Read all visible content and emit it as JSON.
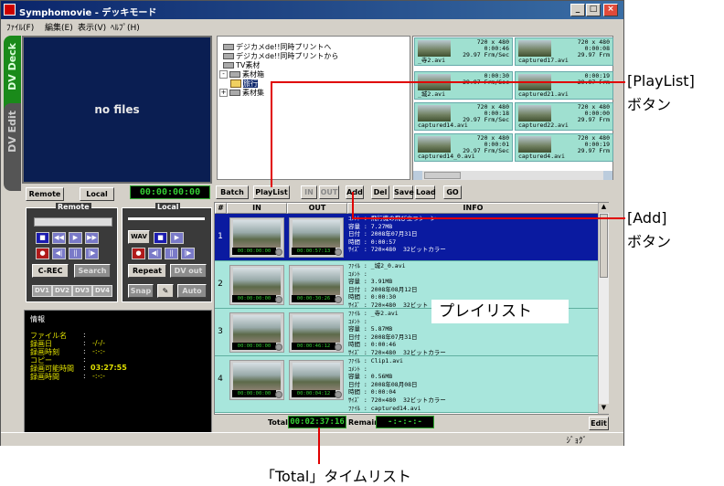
{
  "window": {
    "title": "Symphomovie - デッキモード",
    "controls": [
      "_",
      "□",
      "×"
    ]
  },
  "menu": [
    "ﾌｧｲﾙ(F)",
    "編集(E)",
    "表示(V)",
    "ﾍﾙﾌﾟ(H)"
  ],
  "side_tabs": {
    "deck": "DV Deck",
    "edit": "DV Edit"
  },
  "preview": {
    "text": "no files"
  },
  "tree": {
    "items": [
      {
        "label": "デジカメde!!同時プリントへ",
        "type": "drive"
      },
      {
        "label": "デジカメde!!同時プリントから",
        "type": "drive"
      },
      {
        "label": "TV素材",
        "type": "drive"
      },
      {
        "label": "素材箱",
        "type": "folder",
        "expanded": true
      },
      {
        "label": "旅行",
        "type": "folder",
        "selected": true
      },
      {
        "label": "素材集",
        "type": "folder"
      }
    ]
  },
  "thumbs": [
    {
      "name": "_寺2.avi",
      "res": "720 x 480",
      "dur": "0:00:46",
      "fps": "29.97 Frm/Sec"
    },
    {
      "name": "captured17.avi",
      "res": "720 x 480",
      "dur": "0:00:08",
      "fps": "29.97 Frm"
    },
    {
      "name": "_城2.avi",
      "res": "",
      "dur": "0:00:30",
      "fps": "29.97 Frm/Sec"
    },
    {
      "name": "captured21.avi",
      "res": "",
      "dur": "0:00:19",
      "fps": "29.97 Frm"
    },
    {
      "name": "captured14.avi",
      "res": "720 x 480",
      "dur": "0:00:18",
      "fps": "29.97 Frm/Sec"
    },
    {
      "name": "captured22.avi",
      "res": "720 x 480",
      "dur": "0:00:00",
      "fps": "29.97 Frm"
    },
    {
      "name": "captured14_0.avi",
      "res": "720 x 480",
      "dur": "0:00:01",
      "fps": "29.97 Frm/Sec"
    },
    {
      "name": "captured4.avi",
      "res": "720 x 480",
      "dur": "0:00:19",
      "fps": "29.97 Frm"
    }
  ],
  "deck": {
    "remote_btn": "Remote",
    "local_btn": "Local",
    "timecode": "00:00:00:00",
    "remote_group": "Remote",
    "local_group": "Local",
    "crec": "C-REC",
    "search": "Search",
    "repeat": "Repeat",
    "dvout": "DV out",
    "wav": "WAV",
    "snap": "Snap",
    "auto": "Auto",
    "dv_buttons": [
      "DV1",
      "DV2",
      "DV3",
      "DV4"
    ]
  },
  "info": {
    "heading": "情報",
    "rows": [
      {
        "label": "ファイル名",
        "value": ""
      },
      {
        "label": "録画日",
        "value": "-/-/-"
      },
      {
        "label": "録画時刻",
        "value": "-:-:-"
      },
      {
        "label": "コピー",
        "value": ""
      },
      {
        "label": "録画可能時間",
        "value": "03:27:55"
      },
      {
        "label": "録画時間",
        "value": "-:-:-"
      }
    ]
  },
  "toolbar": {
    "batch": "Batch",
    "playlist": "PlayList",
    "in": "IN",
    "out": "OUT",
    "add": "Add",
    "del": "Del",
    "save": "Save",
    "load": "Load",
    "go": "GO"
  },
  "table": {
    "headers": [
      "#",
      "IN",
      "OUT",
      "INFO"
    ],
    "rows": [
      {
        "num": "1",
        "in_tc": "00:00:00:00",
        "out_tc": "00:00:57:13",
        "info": "ｺﾒﾝﾄ : 飛行機の飛び立つシーン\n容量 : 7.27MB\n日付 : 2008年07月31日\n時間 : 0:00:57\nｻｲｽﾞ : 720×480  32ビットカラー"
      },
      {
        "num": "2",
        "in_tc": "00:00:00:00",
        "out_tc": "00:00:30:26",
        "info": "ﾌｧｲﾙ : _城2_0.avi\nｺﾒﾝﾄ :\n容量 : 3.91MB\n日付 : 2008年08月12日\n時間 : 0:00:30\nｻｲｽﾞ : 720×480  32ビット"
      },
      {
        "num": "3",
        "in_tc": "00:00:00:00",
        "out_tc": "00:00:46:12",
        "info": "ﾌｧｲﾙ : _寺2.avi\nｺﾒﾝﾄ :\n容量 : 5.87MB\n日付 : 2008年07月31日\n時間 : 0:00:46\nｻｲｽﾞ : 720×480  32ビットカラー"
      },
      {
        "num": "4",
        "in_tc": "00:00:00:00",
        "out_tc": "00:00:04:12",
        "info": "ﾌｧｲﾙ : Clip1.avi\nｺﾒﾝﾄ :\n容量 : 0.56MB\n日付 : 2008年08月08日\n時間 : 0:00:04\nｻｲｽﾞ : 720×480  32ビットカラー\nﾌｧｲﾙ : captured14.avi"
      }
    ]
  },
  "bottom": {
    "total_label": "Total",
    "total_value": "00:02:37:16",
    "remain_label": "Remain",
    "remain_value": "-:-:-:-",
    "edit": "Edit",
    "status_right": "ｼﾞｮｸﾞ"
  },
  "annotations": {
    "playlist": "[PlayList]\nボタン",
    "add": "[Add]\nボタン",
    "overlay": "プレイリスト",
    "total": "「Total」タイムリスト"
  },
  "colors": {
    "accent_green": "#33cc33",
    "callout_red": "#e00000",
    "selected_row": "#0a1aa0",
    "alt_row": "#a8e6dc"
  }
}
